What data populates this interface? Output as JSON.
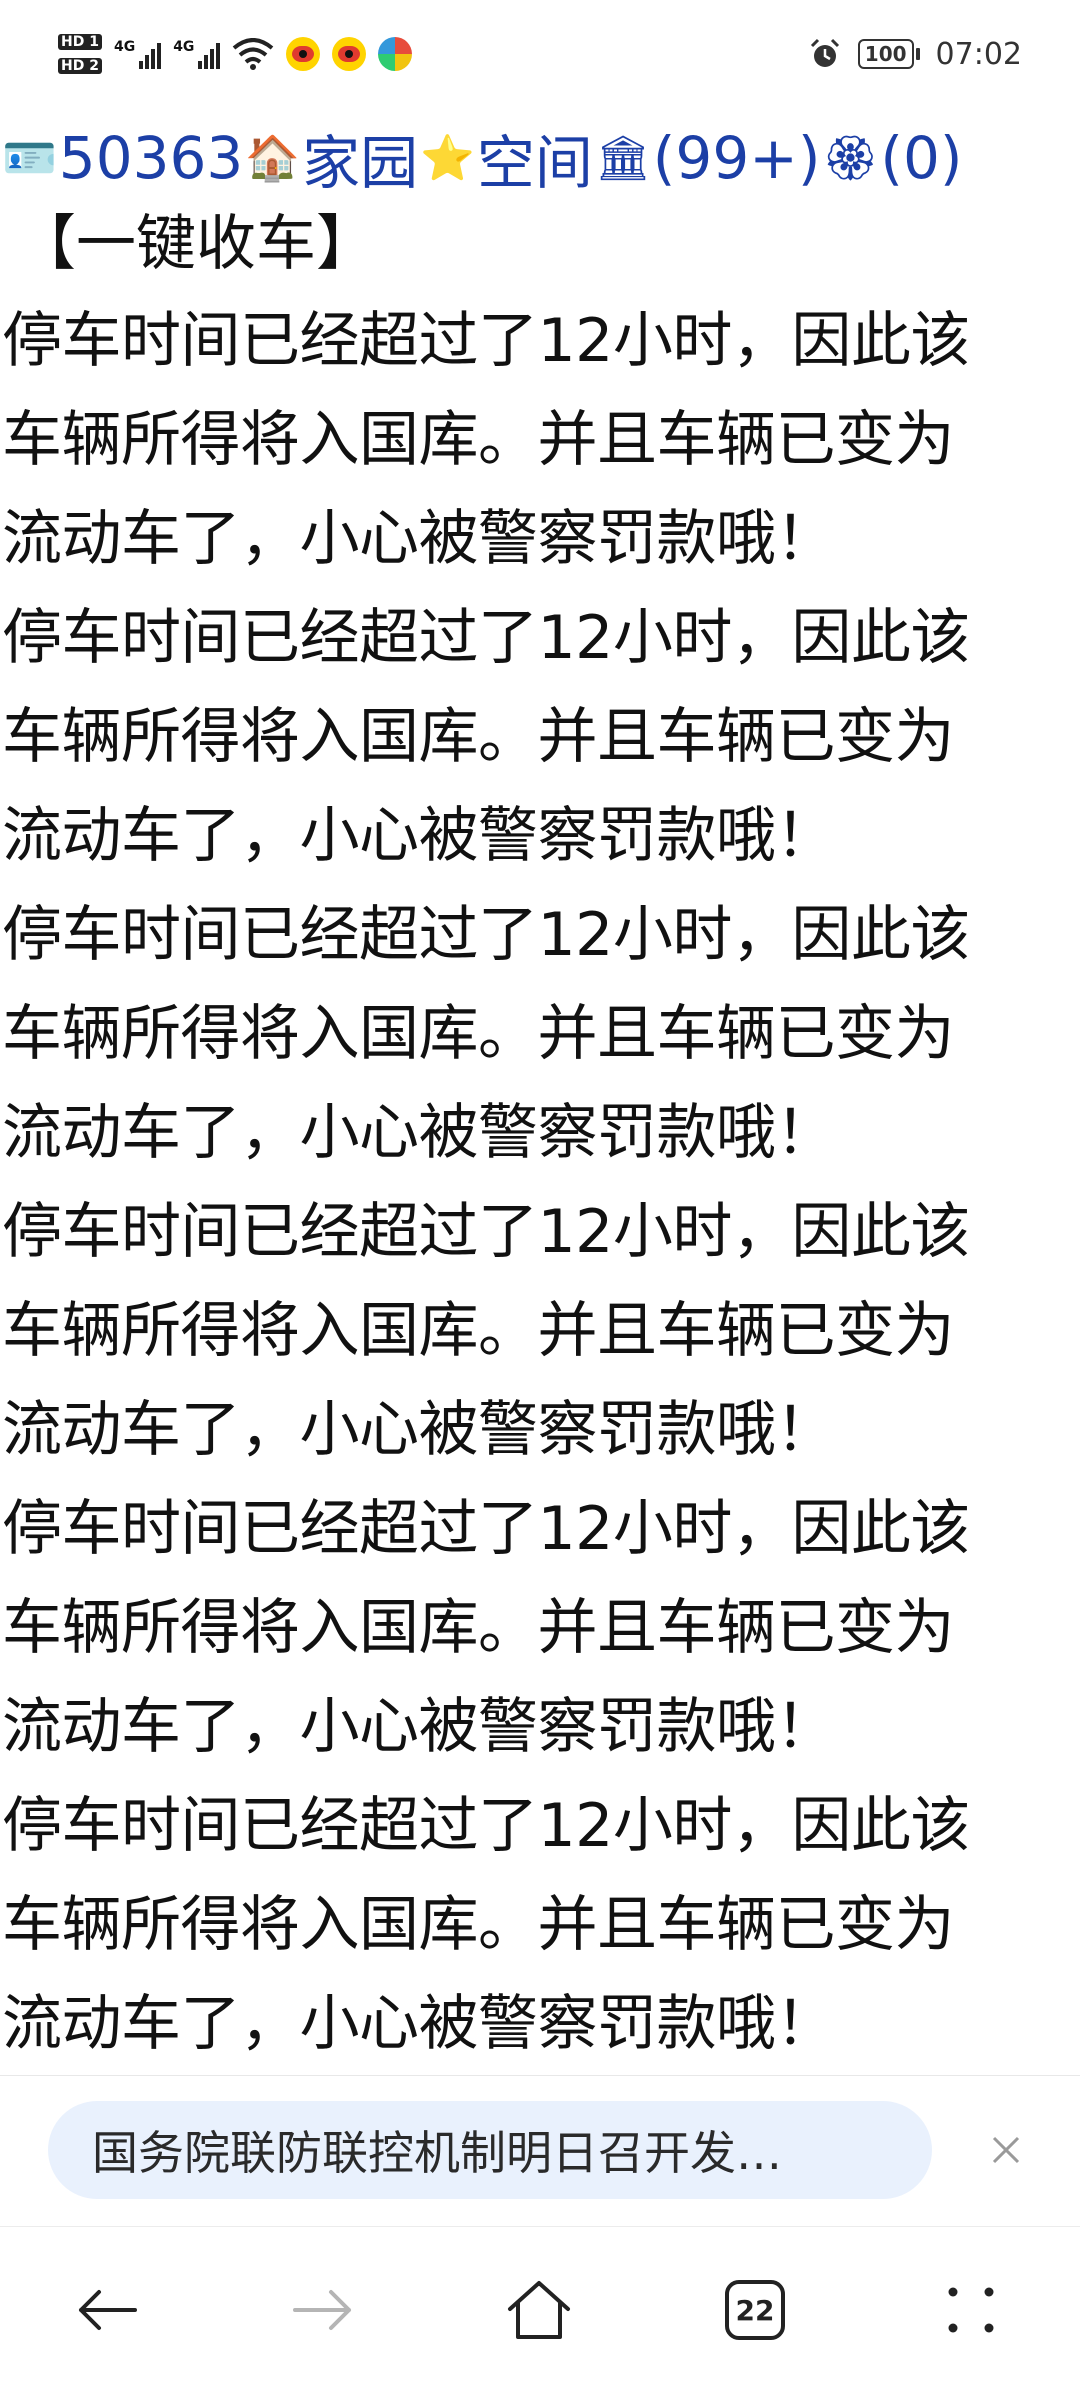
{
  "status_bar": {
    "sim1": "HD 1",
    "sim2": "HD 2",
    "network1": "4G",
    "network2": "4G",
    "battery": "100",
    "time": "07:02"
  },
  "nav_line": {
    "number": "50363",
    "home": "家园",
    "space": "空间",
    "messages": "(99+)",
    "other": "(0)"
  },
  "title": "【一键收车】",
  "paragraphs": [
    {
      "l1": "停车时间已经超过了12小时，因此该",
      "l2": "车辆所得将入国库。并且车辆已变为",
      "l3": "流动车了，小心被警察罚款哦！"
    },
    {
      "l1": "停车时间已经超过了12小时，因此该",
      "l2": "车辆所得将入国库。并且车辆已变为",
      "l3": "流动车了，小心被警察罚款哦！"
    },
    {
      "l1": "停车时间已经超过了12小时，因此该",
      "l2": "车辆所得将入国库。并且车辆已变为",
      "l3": "流动车了，小心被警察罚款哦！"
    },
    {
      "l1": "停车时间已经超过了12小时，因此该",
      "l2": "车辆所得将入国库。并且车辆已变为",
      "l3": "流动车了，小心被警察罚款哦！"
    },
    {
      "l1": "停车时间已经超过了12小时，因此该",
      "l2": "车辆所得将入国库。并且车辆已变为",
      "l3": "流动车了，小心被警察罚款哦！"
    },
    {
      "l1": "停车时间已经超过了12小时，因此该",
      "l2": "车辆所得将入国库。并且车辆已变为",
      "l3": "流动车了，小心被警察罚款哦！"
    }
  ],
  "news_bar": {
    "headline": "国务院联防联控机制明日召开发…"
  },
  "bottom_nav": {
    "tab_count": "22"
  },
  "icons": {
    "back": "back-arrow-icon",
    "forward": "forward-arrow-icon",
    "home": "home-icon",
    "tabs": "tabs-icon",
    "menu": "menu-icon",
    "close": "close-icon"
  },
  "colors": {
    "link": "#1c3fa6",
    "news_pill": "#e9f1fd"
  }
}
